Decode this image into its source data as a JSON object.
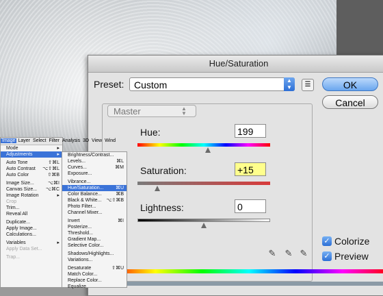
{
  "dialog": {
    "title": "Hue/Saturation",
    "preset_label": "Preset:",
    "preset_value": "Custom",
    "ok_label": "OK",
    "cancel_label": "Cancel",
    "channel": "Master",
    "hue": {
      "label": "Hue:",
      "value": "199"
    },
    "saturation": {
      "label": "Saturation:",
      "value": "+15"
    },
    "lightness": {
      "label": "Lightness:",
      "value": "0"
    },
    "colorize": {
      "label": "Colorize",
      "checked": true
    },
    "preview": {
      "label": "Preview",
      "checked": true
    }
  },
  "menubar": {
    "items": [
      "Image",
      "Layer",
      "Select",
      "Filter",
      "Analysis",
      "3D",
      "View",
      "Wind"
    ]
  },
  "image_menu": [
    {
      "label": "Mode",
      "shortcut": "▸"
    },
    {
      "label": "Adjustments",
      "shortcut": "▸",
      "selected": true
    },
    {
      "sep": true
    },
    {
      "label": "Auto Tone",
      "shortcut": "⇧⌘L"
    },
    {
      "label": "Auto Contrast",
      "shortcut": "⌥⇧⌘L"
    },
    {
      "label": "Auto Color",
      "shortcut": "⇧⌘B"
    },
    {
      "sep": true
    },
    {
      "label": "Image Size...",
      "shortcut": "⌥⌘I"
    },
    {
      "label": "Canvas Size...",
      "shortcut": "⌥⌘C"
    },
    {
      "label": "Image Rotation",
      "shortcut": "▸"
    },
    {
      "label": "Crop",
      "disabled": true
    },
    {
      "label": "Trim..."
    },
    {
      "label": "Reveal All"
    },
    {
      "sep": true
    },
    {
      "label": "Duplicate..."
    },
    {
      "label": "Apply Image..."
    },
    {
      "label": "Calculations..."
    },
    {
      "sep": true
    },
    {
      "label": "Variables",
      "shortcut": "▸"
    },
    {
      "label": "Apply Data Set...",
      "disabled": true
    },
    {
      "sep": true
    },
    {
      "label": "Trap...",
      "disabled": true
    }
  ],
  "adjustments_menu": [
    {
      "label": "Brightness/Contrast..."
    },
    {
      "label": "Levels...",
      "shortcut": "⌘L"
    },
    {
      "label": "Curves...",
      "shortcut": "⌘M"
    },
    {
      "label": "Exposure..."
    },
    {
      "sep": true
    },
    {
      "label": "Vibrance..."
    },
    {
      "label": "Hue/Saturation...",
      "shortcut": "⌘U",
      "selected": true
    },
    {
      "label": "Color Balance...",
      "shortcut": "⌘B"
    },
    {
      "label": "Black & White...",
      "shortcut": "⌥⇧⌘B"
    },
    {
      "label": "Photo Filter..."
    },
    {
      "label": "Channel Mixer..."
    },
    {
      "sep": true
    },
    {
      "label": "Invert",
      "shortcut": "⌘I"
    },
    {
      "label": "Posterize..."
    },
    {
      "label": "Threshold..."
    },
    {
      "label": "Gradient Map..."
    },
    {
      "label": "Selective Color..."
    },
    {
      "sep": true
    },
    {
      "label": "Shadows/Highlights..."
    },
    {
      "label": "Variations..."
    },
    {
      "sep": true
    },
    {
      "label": "Desaturate",
      "shortcut": "⇧⌘U"
    },
    {
      "label": "Match Color..."
    },
    {
      "label": "Replace Color..."
    },
    {
      "label": "Equalize"
    }
  ],
  "sliders": {
    "hue": 0.53,
    "saturation": 0.15,
    "lightness": 0.5
  },
  "colors": {
    "accent": "#3b73d8",
    "ok_button": "#6aa6ee",
    "highlight": "#ffff8c"
  }
}
